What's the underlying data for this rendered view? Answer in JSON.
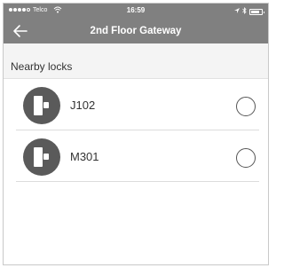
{
  "status_bar": {
    "carrier": "Telco",
    "time": "16:59"
  },
  "nav": {
    "title": "2nd Floor Gateway"
  },
  "section": {
    "title": "Nearby locks"
  },
  "locks": [
    {
      "name": "J102",
      "selected": false
    },
    {
      "name": "M301",
      "selected": false
    }
  ],
  "colors": {
    "header": "#808080",
    "avatar": "#5a5a5a",
    "section_bg": "#f4f4f4"
  }
}
